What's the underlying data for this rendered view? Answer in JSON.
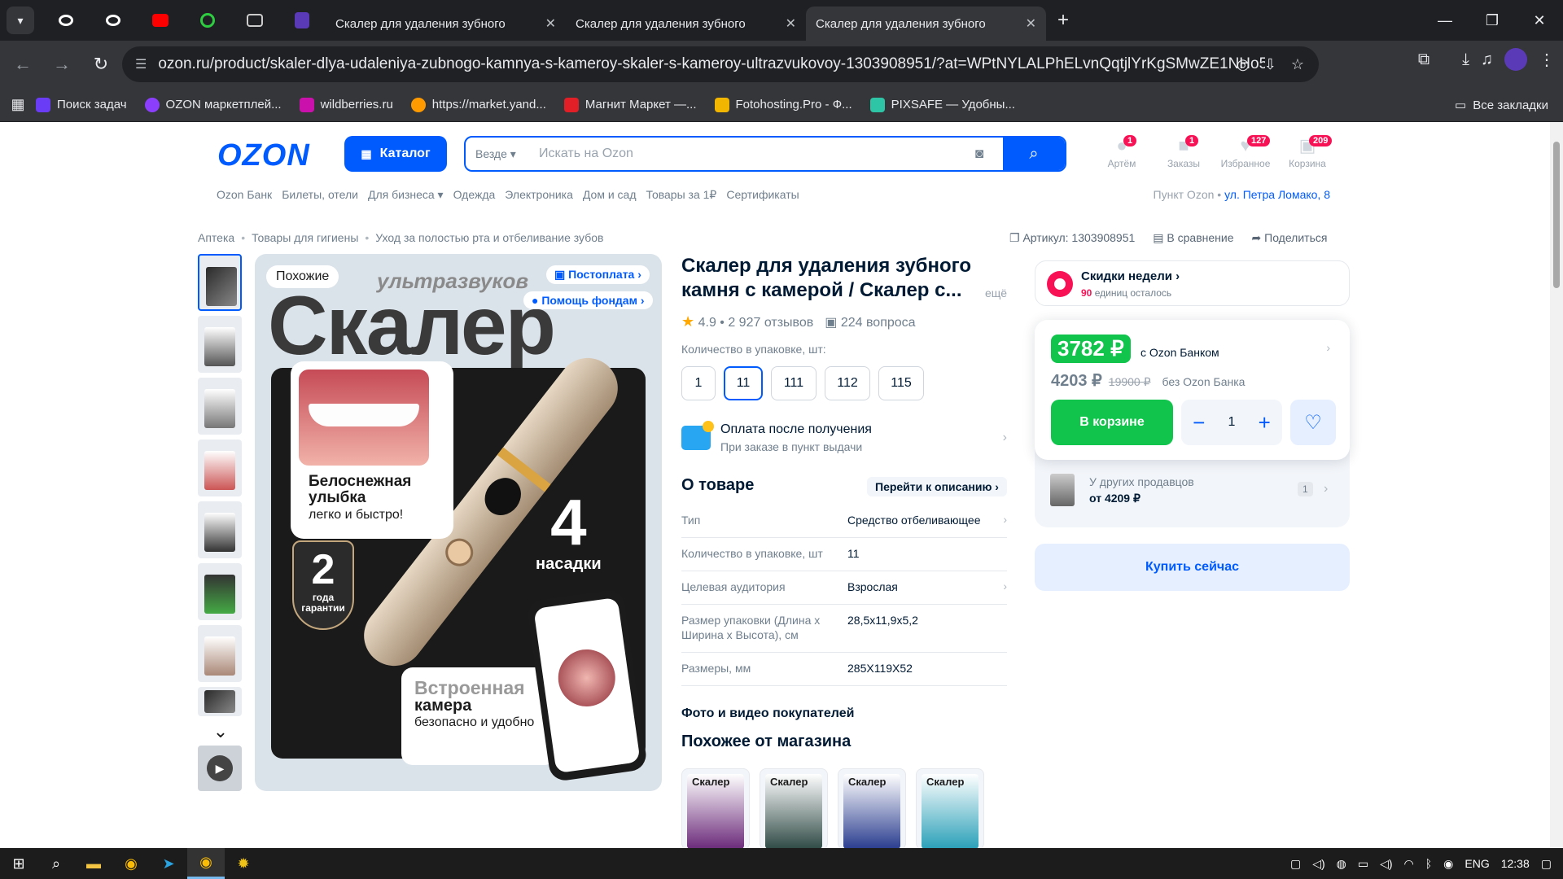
{
  "browser": {
    "tabs": [
      {
        "title": "Скалер для удаления зубного",
        "active": false
      },
      {
        "title": "Скалер для удаления зубного",
        "active": false
      },
      {
        "title": "Скалер для удаления зубного",
        "active": true
      }
    ],
    "url": "ozon.ru/product/skaler-dlya-udaleniya-zubnogo-kamnya-s-kameroy-skaler-s-kameroy-ultrazvukovoy-1303908951/?at=WPtNYLALPhELvnQqtjlYrKgSMwZE1NHo502MKFo...",
    "bookmarks": [
      {
        "label": "Поиск задач",
        "color": "#6b3cf5"
      },
      {
        "label": "OZON маркетплей...",
        "color": "#8b3ffd"
      },
      {
        "label": "wildberries.ru",
        "color": "#cb11ab"
      },
      {
        "label": "https://market.yand...",
        "color": "#ff9a00"
      },
      {
        "label": "Магнит Маркет —...",
        "color": "#e21e26"
      },
      {
        "label": "Fotohosting.Pro - Ф...",
        "color": "#f2b500"
      },
      {
        "label": "PIXSAFE — Удобны...",
        "color": "#2ec4a6"
      }
    ],
    "all_bookmarks": "Все закладки"
  },
  "header": {
    "logo": "OZON",
    "catalog": "Каталог",
    "search_scope": "Везде",
    "search_placeholder": "Искать на Ozon",
    "icons": [
      {
        "label": "Артём",
        "badge": "1"
      },
      {
        "label": "Заказы",
        "badge": "1"
      },
      {
        "label": "Избранное",
        "badge": "127"
      },
      {
        "label": "Корзина",
        "badge": "209"
      }
    ],
    "subnav": [
      "Ozon Банк",
      "Билеты, отели",
      "Для бизнеса",
      "Одежда",
      "Электроника",
      "Дом и сад",
      "Товары за 1₽",
      "Сертификаты"
    ],
    "pickup_label": "Пункт Ozon •",
    "pickup_address": "ул. Петра Ломако, 8"
  },
  "breadcrumbs": [
    "Аптека",
    "Товары для гигиены",
    "Уход за полостью рта и отбеливание зубов"
  ],
  "meta": {
    "article": "Артикул: 1303908951",
    "compare": "В сравнение",
    "share": "Поделиться"
  },
  "gallery": {
    "similar_chip": "Похожие",
    "postpay_chip": "Постоплата",
    "charity_chip": "Помощь фондам",
    "big_word": "Скалер",
    "ultra_word": "ультразвуков",
    "smile_title": "Белоснежная улыбка",
    "smile_sub": "легко и быстро!",
    "warranty_num": "2",
    "warranty_txt": "года гарантии",
    "nozzles_num": "4",
    "nozzles_txt": "насадки",
    "camera_t1": "Встроенная",
    "camera_t2": "камера",
    "camera_t3": "безопасно и удобно"
  },
  "product": {
    "title": "Скалер для удаления зубного камня с камерой / Скалер с...",
    "more": "ещё",
    "rating": "4.9 • 2 927 отзывов",
    "questions": "224 вопроса",
    "qty_label": "Количество в упаковке, шт:",
    "qty_options": [
      "1",
      "11",
      "111",
      "112",
      "115"
    ],
    "qty_selected": "11",
    "pay_title": "Оплата после получения",
    "pay_sub": "При заказе в пункт выдачи",
    "about": "О товаре",
    "goto_desc": "Перейти к описанию",
    "specs": [
      {
        "k": "Тип",
        "v": "Средство отбеливающее"
      },
      {
        "k": "Количество в упаковке, шт",
        "v": "11"
      },
      {
        "k": "Целевая аудитория",
        "v": "Взрослая"
      },
      {
        "k": "Размер упаковки (Длина х Ширина х Высота), см",
        "v": "28,5x11,9x5,2"
      },
      {
        "k": "Размеры, мм",
        "v": "285X119X52"
      }
    ],
    "photos_title": "Фото и видео покупателей",
    "similar_title": "Похожее от магазина",
    "similar_label": "Скалер"
  },
  "buy": {
    "promo_title": "Скидки недели",
    "promo_count": "90",
    "promo_sub": "единиц осталось",
    "price_bank": "3782 ₽",
    "with_bank": "с Ozon Банком",
    "price": "4203 ₽",
    "price_old": "19900 ₽",
    "without_bank": "без Ozon Банка",
    "in_cart": "В корзине",
    "qty": "1",
    "others_title": "У других продавцов",
    "others_price": "от 4209 ₽",
    "others_count": "1",
    "buy_now": "Купить сейчас"
  },
  "taskbar": {
    "lang": "ENG",
    "time": "12:38"
  },
  "colors": {
    "ozon_blue": "#005bff",
    "green": "#10c44c",
    "pink": "#f91155"
  }
}
